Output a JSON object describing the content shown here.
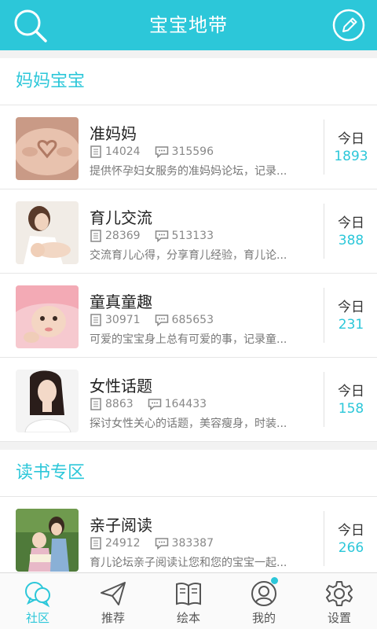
{
  "header": {
    "title": "宝宝地带",
    "search_icon": "search-icon",
    "edit_icon": "edit-icon"
  },
  "sections": [
    {
      "title": "妈妈宝宝",
      "forums": [
        {
          "name": "准妈妈",
          "threads": "14024",
          "posts": "315596",
          "desc": "提供怀孕妇女服务的准妈妈论坛，记录...",
          "today_label": "今日",
          "today": "1893",
          "thumb": "pregnant-belly-image"
        },
        {
          "name": "育儿交流",
          "threads": "28369",
          "posts": "513133",
          "desc": "交流育儿心得，分享育儿经验，育儿论...",
          "today_label": "今日",
          "today": "388",
          "thumb": "mother-baby-image"
        },
        {
          "name": "童真童趣",
          "threads": "30971",
          "posts": "685653",
          "desc": "可爱的宝宝身上总有可爱的事，记录童...",
          "today_label": "今日",
          "today": "231",
          "thumb": "baby-blanket-image"
        },
        {
          "name": "女性话题",
          "threads": "8863",
          "posts": "164433",
          "desc": "探讨女性关心的话题，美容瘦身，时装...",
          "today_label": "今日",
          "today": "158",
          "thumb": "woman-portrait-image"
        }
      ]
    },
    {
      "title": "读书专区",
      "forums": [
        {
          "name": "亲子阅读",
          "threads": "24912",
          "posts": "383387",
          "desc": "育儿论坛亲子阅读让您和您的宝宝一起...",
          "today_label": "今日",
          "today": "266",
          "thumb": "parent-child-reading-image"
        }
      ]
    }
  ],
  "tabs": [
    {
      "label": "社区",
      "icon": "community-icon",
      "active": true
    },
    {
      "label": "推荐",
      "icon": "paper-plane-icon",
      "active": false
    },
    {
      "label": "绘本",
      "icon": "book-icon",
      "active": false
    },
    {
      "label": "我的",
      "icon": "profile-icon",
      "active": false,
      "badge": true
    },
    {
      "label": "设置",
      "icon": "gear-icon",
      "active": false
    }
  ],
  "colors": {
    "accent": "#2cc7d9",
    "background": "#f2f2f2"
  }
}
